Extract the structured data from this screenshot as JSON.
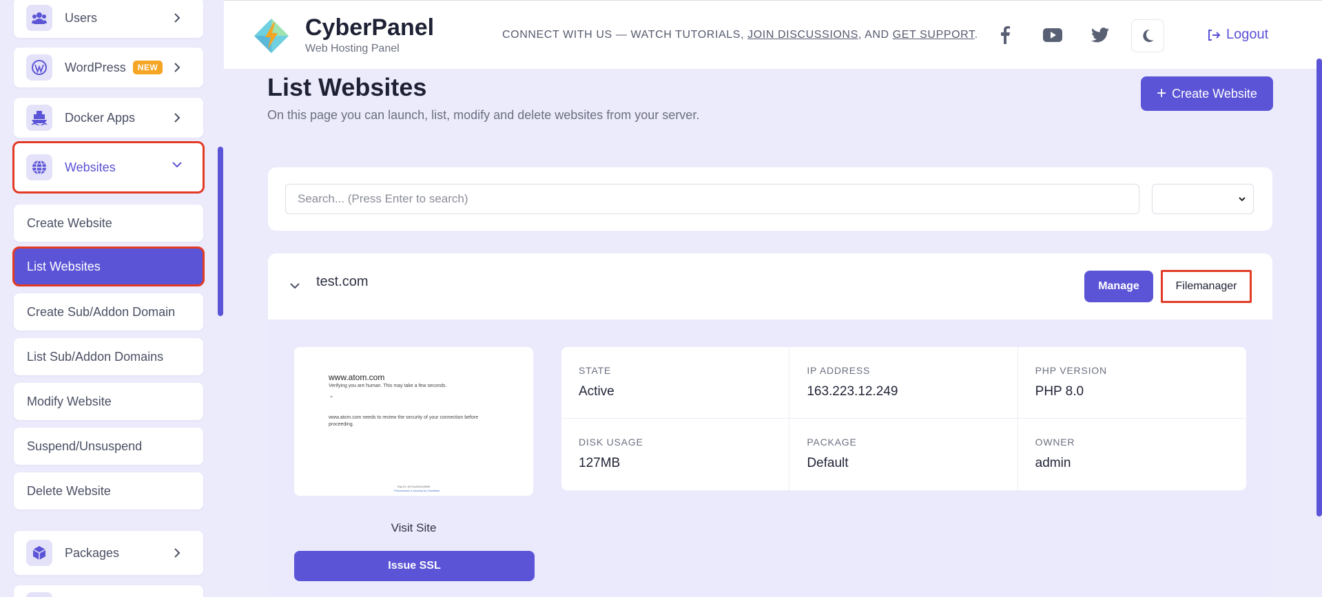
{
  "sidebar": {
    "items": [
      {
        "label": "Users",
        "icon": "users-icon"
      },
      {
        "label": "WordPress",
        "icon": "wordpress-icon",
        "badge": "NEW"
      },
      {
        "label": "Docker Apps",
        "icon": "docker-icon"
      },
      {
        "label": "Websites",
        "icon": "globe-icon",
        "expanded": true
      },
      {
        "label": "Packages",
        "icon": "package-icon"
      }
    ],
    "websites_submenu": [
      {
        "label": "Create Website"
      },
      {
        "label": "List Websites",
        "selected": true
      },
      {
        "label": "Create Sub/Addon Domain"
      },
      {
        "label": "List Sub/Addon Domains"
      },
      {
        "label": "Modify Website"
      },
      {
        "label": "Suspend/Unsuspend"
      },
      {
        "label": "Delete Website"
      }
    ]
  },
  "header": {
    "brand_name": "CyberPanel",
    "brand_sub": "Web Hosting Panel",
    "connect_prefix": "CONNECT WITH US — WATCH TUTORIALS, ",
    "connect_link1": "JOIN DISCUSSIONS",
    "connect_middle": ", AND ",
    "connect_link2": "GET SUPPORT",
    "connect_suffix": ".",
    "social_icons": [
      "facebook-icon",
      "youtube-icon",
      "twitter-icon"
    ],
    "logout_label": "Logout"
  },
  "main": {
    "title": "List Websites",
    "description": "On this page you can launch, list, modify and delete websites from your server.",
    "create_button": "Create Website",
    "search_placeholder": "Search... (Press Enter to search)",
    "filter_value": ""
  },
  "website": {
    "domain": "test.com",
    "manage_label": "Manage",
    "filemanager_label": "Filemanager",
    "preview": {
      "domain": "www.atom.com",
      "verify": "Verifying you are human. This may take a few seconds.",
      "dash": "-",
      "review": "www.atom.com needs to review the security of your connection before proceeding.",
      "foot1": "Ray ID: 8c7f1a2b3c4d5e6f",
      "foot2": "Performance & security by Cloudflare"
    },
    "visit_site": "Visit Site",
    "issue_ssl": "Issue SSL",
    "info": [
      {
        "label": "STATE",
        "value": "Active"
      },
      {
        "label": "IP ADDRESS",
        "value": "163.223.12.249"
      },
      {
        "label": "PHP VERSION",
        "value": "PHP 8.0"
      },
      {
        "label": "DISK USAGE",
        "value": "127MB"
      },
      {
        "label": "PACKAGE",
        "value": "Default"
      },
      {
        "label": "OWNER",
        "value": "admin"
      }
    ]
  },
  "colors": {
    "accent": "#5b54d6",
    "highlight_box": "#e23a24",
    "badge": "#f5a524",
    "background": "#ecebfb"
  }
}
